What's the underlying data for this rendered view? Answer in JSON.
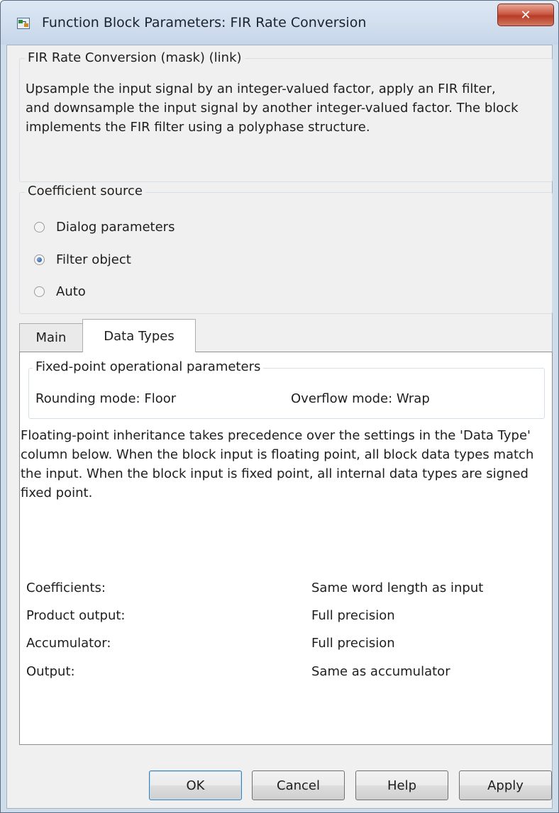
{
  "window": {
    "title": "Function Block Parameters: FIR Rate Conversion",
    "close_label": "✕"
  },
  "mask": {
    "legend": "FIR Rate Conversion (mask) (link)",
    "description": "Upsample the input signal by an integer-valued factor, apply an FIR filter, and downsample the input signal by another integer-valued factor. The block implements the FIR filter using a polyphase structure."
  },
  "coefficient_source": {
    "legend": "Coefficient source",
    "options": [
      {
        "label": "Dialog parameters",
        "checked": false
      },
      {
        "label": "Filter object",
        "checked": true
      },
      {
        "label": "Auto",
        "checked": false
      }
    ]
  },
  "tabs": [
    {
      "label": "Main",
      "active": false
    },
    {
      "label": "Data Types",
      "active": true
    }
  ],
  "data_types": {
    "fixed_point_legend": "Fixed-point operational parameters",
    "rounding_mode": "Rounding mode:  Floor",
    "overflow_mode": "Overflow mode:  Wrap",
    "note": "Floating-point inheritance takes precedence over the settings in the 'Data Type' column below. When the block input is floating point, all block data types match the input. When the block input is fixed point, all internal data types are signed fixed point.",
    "rows": [
      {
        "label": "Coefficients:",
        "value": "Same word length as input"
      },
      {
        "label": "Product output:",
        "value": "Full precision"
      },
      {
        "label": "Accumulator:",
        "value": "Full precision"
      },
      {
        "label": "Output:",
        "value": "Same as accumulator"
      }
    ]
  },
  "buttons": {
    "ok": "OK",
    "cancel": "Cancel",
    "help": "Help",
    "apply": "Apply"
  },
  "colors": {
    "title_bar": "#c6d6e9",
    "close_button": "#c94a35",
    "radio_selected": "#1f4f97",
    "dialog_background": "#f0f0f0"
  }
}
